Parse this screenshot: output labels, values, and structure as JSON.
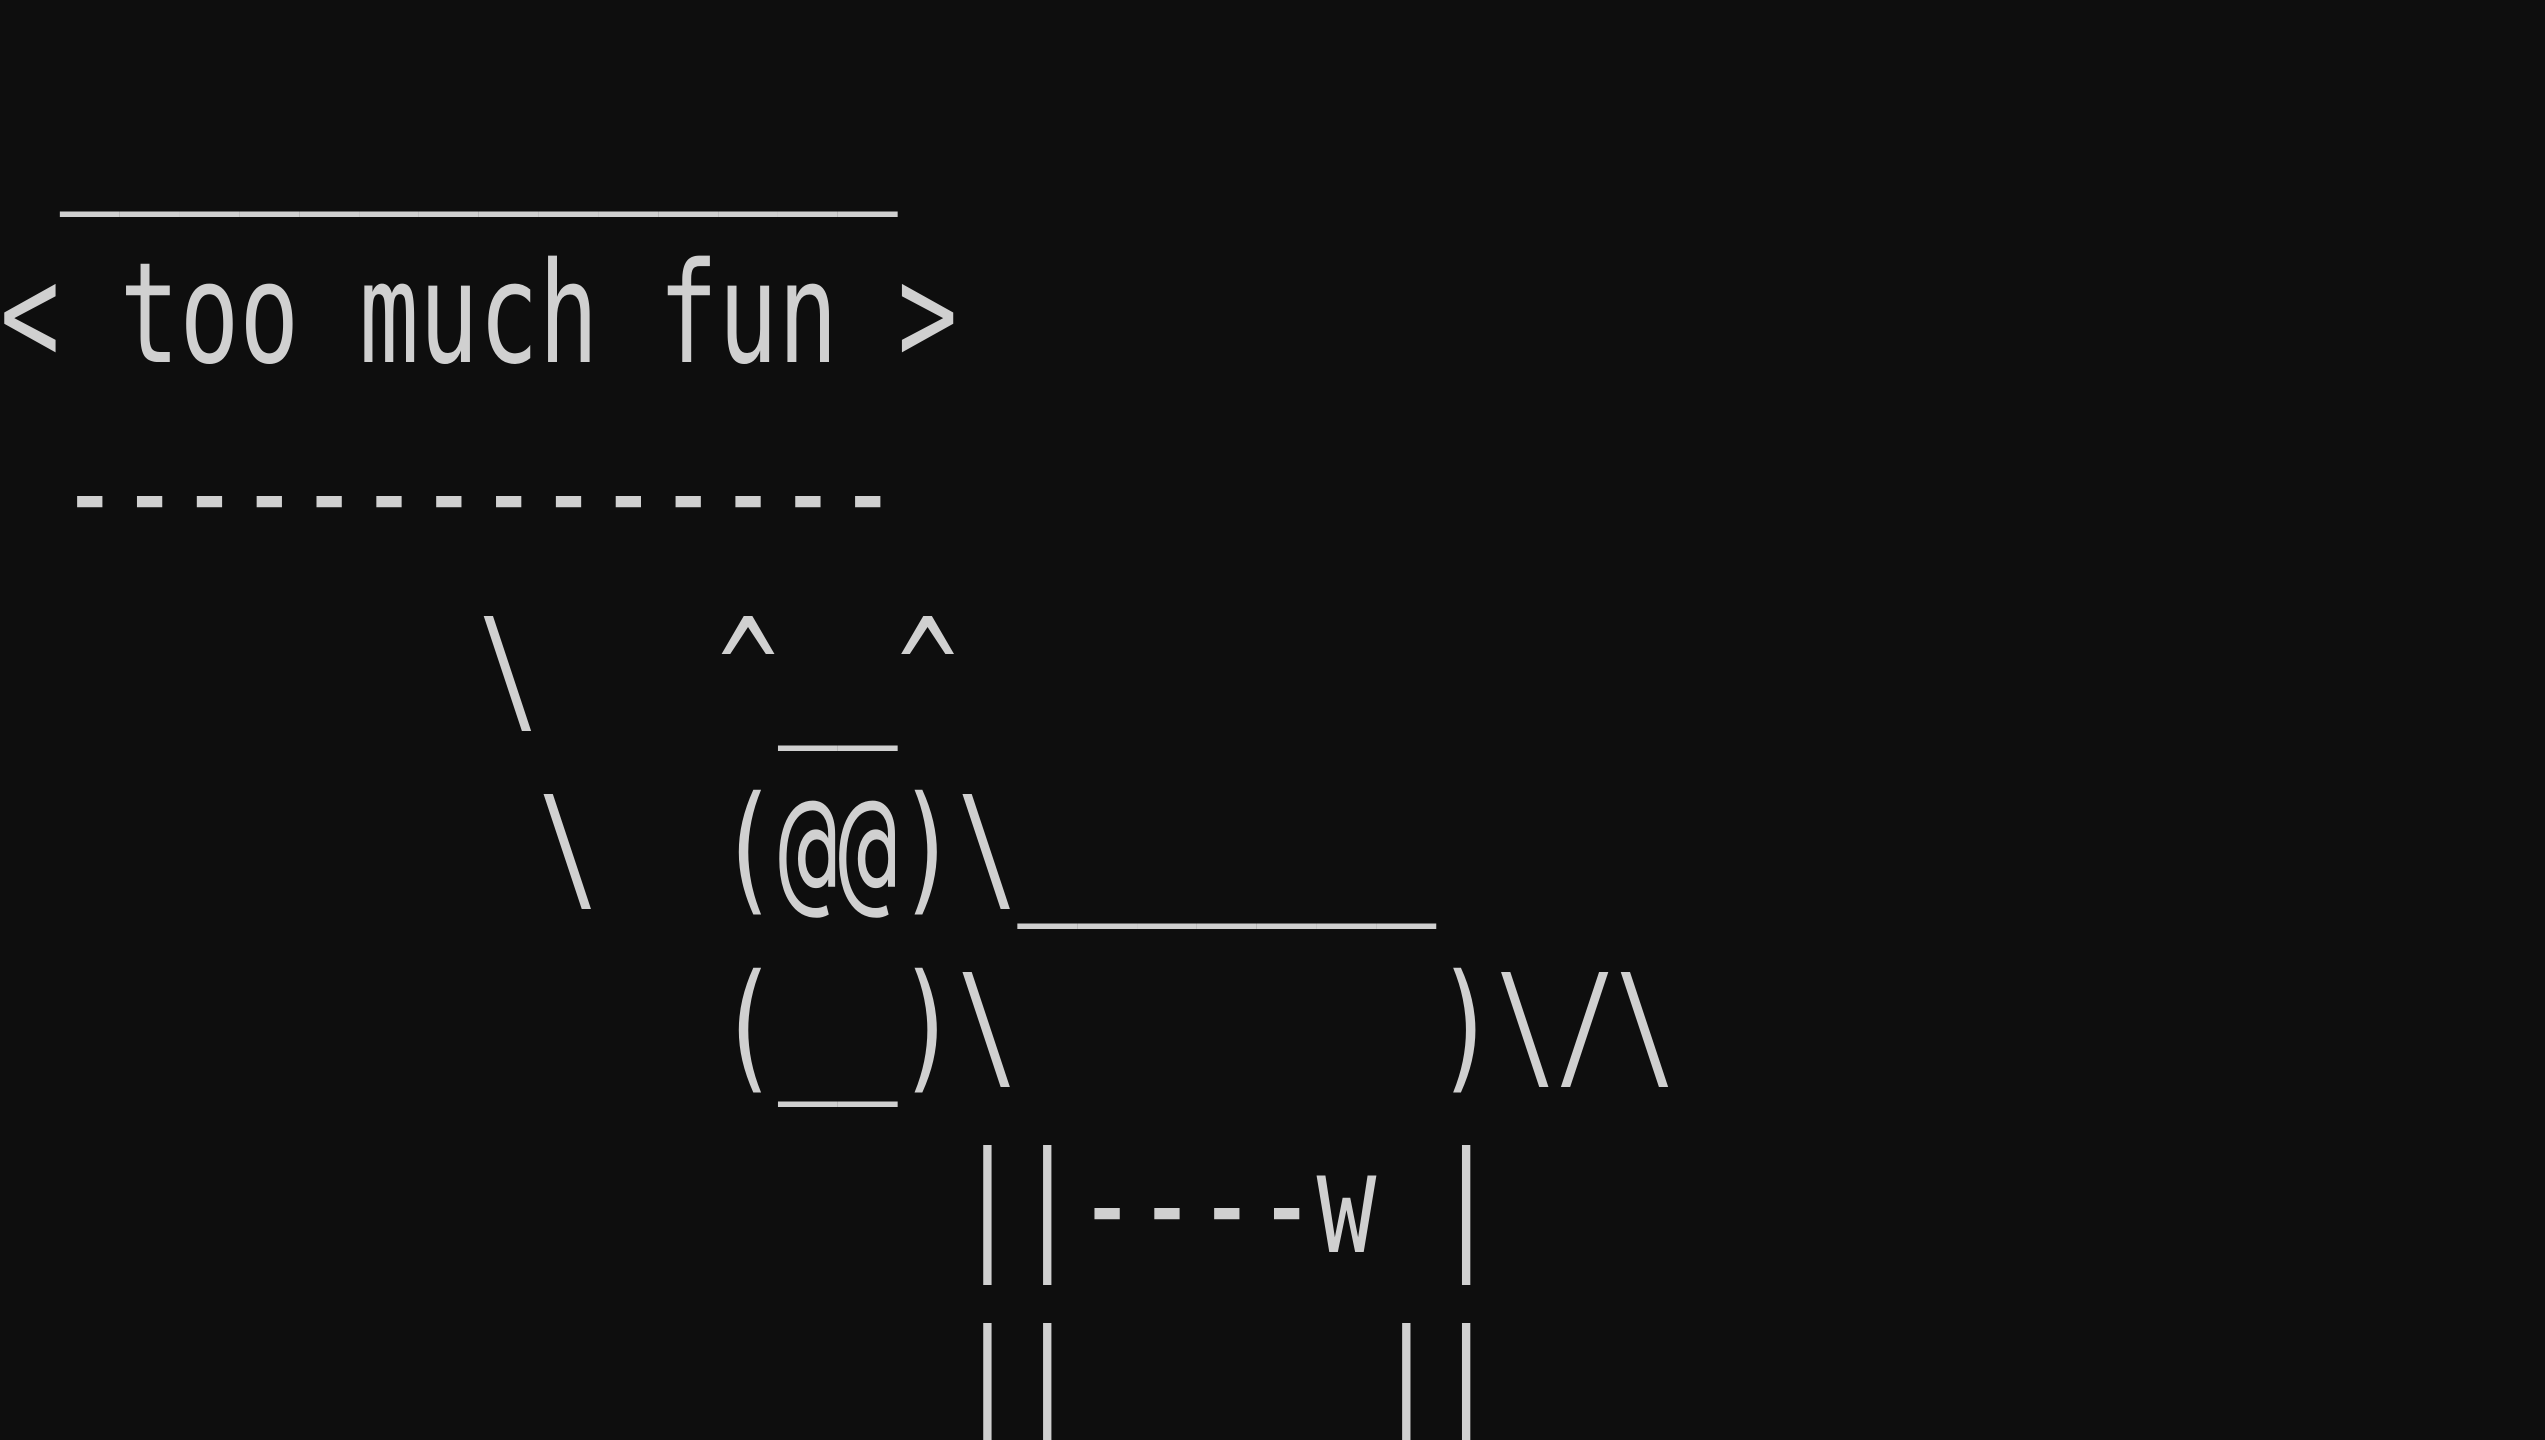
{
  "terminal": {
    "lines": [
      " ______________",
      "< too much fun >",
      " --------------",
      "        \\   ^__^",
      "         \\  (@@)\\_______",
      "            (__)\\       )\\/\\",
      "                ||----w |",
      "                ||     ||"
    ]
  },
  "colors": {
    "background": "#0e0e0e",
    "foreground": "#d0d0d0"
  }
}
